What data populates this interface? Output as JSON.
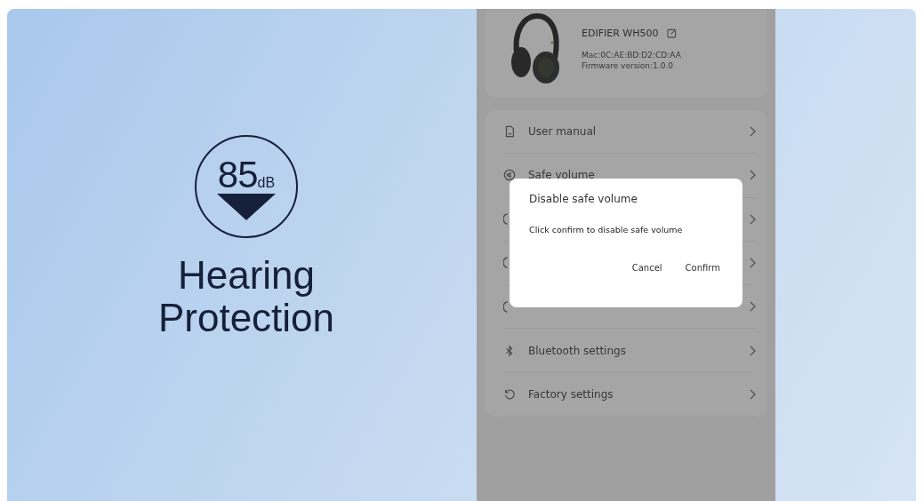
{
  "promo": {
    "badge_value": "85",
    "badge_unit": "dB",
    "headline": [
      "Hearing",
      "Protection"
    ]
  },
  "device": {
    "name": "EDIFIER WH500",
    "mac": "Mac:0C:AE:BD:D2:CD:AA",
    "firmware": "Firmware version:1.0.0"
  },
  "menu": [
    {
      "kind": "labeled",
      "label": "User manual"
    },
    {
      "kind": "labeled",
      "label": "Safe volume"
    },
    {
      "kind": "covered"
    },
    {
      "kind": "covered"
    },
    {
      "kind": "covered"
    },
    {
      "kind": "labeled",
      "label": "Bluetooth settings"
    },
    {
      "kind": "labeled",
      "label": "Factory settings"
    }
  ],
  "dialog": {
    "title": "Disable safe volume",
    "message": "Click confirm to disable safe volume",
    "buttons": [
      "Cancel",
      "Confirm"
    ]
  }
}
